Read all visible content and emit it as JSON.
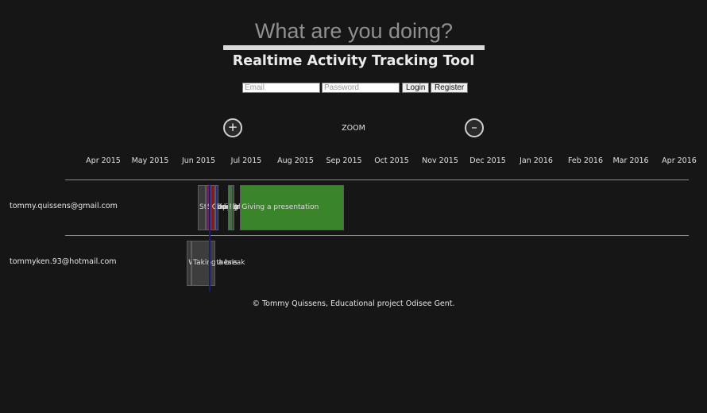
{
  "header": {
    "headline": "What are you doing?",
    "subtitle": "Realtime Activity Tracking Tool"
  },
  "auth": {
    "email_placeholder": "Email",
    "password_placeholder": "Password",
    "login_label": "Login",
    "register_label": "Register"
  },
  "zoom": {
    "in_label": "+",
    "label": "ZOOM",
    "out_label": "–"
  },
  "timeline": {
    "months": [
      "Apr 2015",
      "May 2015",
      "Jun 2015",
      "Jul 2015",
      "Aug 2015",
      "Sep 2015",
      "Oct 2015",
      "Nov 2015",
      "Dec 2015",
      "Jan 2016",
      "Feb 2016",
      "Mar 2016",
      "Apr 2016"
    ],
    "users": [
      {
        "name": "tommy.quissens@gmail.com",
        "activities": [
          {
            "label": "Studying",
            "start": "2015-06-01",
            "end": "2015-06-06",
            "color": "#3a3a3a"
          },
          {
            "label": "Sleeping",
            "start": "2015-06-06",
            "end": "2015-06-09",
            "color": "#5a2a5a"
          },
          {
            "label": "Coding",
            "start": "2015-06-09",
            "end": "2015-06-12",
            "color": "#7a1f1f"
          },
          {
            "label": "Designing",
            "start": "2015-06-12",
            "end": "2015-06-14",
            "color": "#2a2a7a"
          },
          {
            "label": "Relaxing",
            "start": "2015-06-20",
            "end": "2015-06-22",
            "color": "#3f7a3f"
          },
          {
            "label": "Breaking",
            "start": "2015-06-22",
            "end": "2015-06-24",
            "color": "#2e5a2e"
          },
          {
            "label": "Giving a presentation",
            "start": "2015-06-28",
            "end": "2015-09-02",
            "color": "#3a8529"
          }
        ]
      },
      {
        "name": "tommyken.93@hotmail.com",
        "activities": [
          {
            "label": "Writing thesis",
            "start": "2015-05-25",
            "end": "2015-05-28",
            "color": "#3a3a3a"
          },
          {
            "label": "Taking a break",
            "start": "2015-05-28",
            "end": "2015-06-12",
            "color": "#3d3d3d"
          }
        ]
      }
    ]
  },
  "footer": {
    "text": "© Tommy Quissens, Educational project Odisee Gent."
  }
}
